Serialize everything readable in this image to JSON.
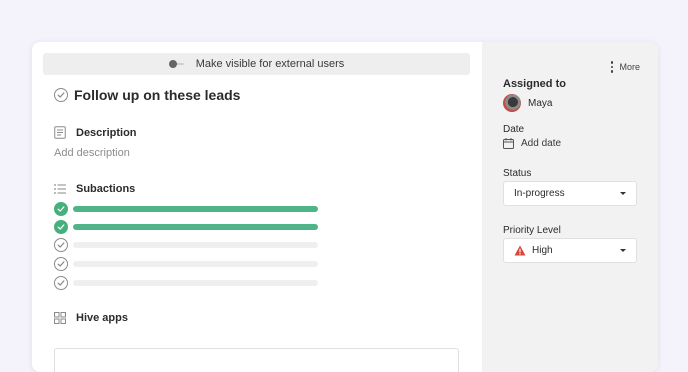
{
  "colors": {
    "accent_green": "#4fb487",
    "warning_red": "#d9453b"
  },
  "visibility": {
    "label": "Make visible for external users",
    "enabled": false
  },
  "task": {
    "title": "Follow up on these leads",
    "completed": false
  },
  "description": {
    "heading": "Description",
    "placeholder": "Add description"
  },
  "subactions": {
    "heading": "Subactions",
    "items": [
      {
        "done": true
      },
      {
        "done": true
      },
      {
        "done": false
      },
      {
        "done": false
      },
      {
        "done": false
      }
    ]
  },
  "hive_apps": {
    "heading": "Hive apps"
  },
  "sidebar": {
    "more_label": "More",
    "assigned_to": {
      "label": "Assigned to",
      "name": "Maya"
    },
    "date": {
      "label": "Date",
      "value": "Add date"
    },
    "status": {
      "label": "Status",
      "value": "In-progress"
    },
    "priority": {
      "label": "Priority Level",
      "value": "High"
    }
  }
}
